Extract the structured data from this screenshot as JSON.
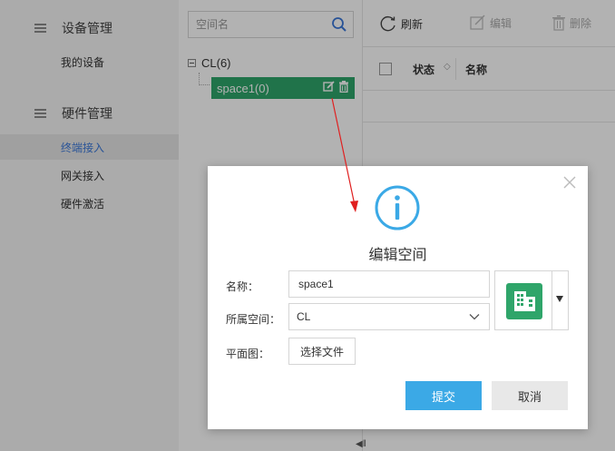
{
  "sidebar": {
    "sections": [
      {
        "title": "设备管理",
        "icon": "menu-icon",
        "items": [
          {
            "label": "我的设备",
            "active": false
          }
        ]
      },
      {
        "title": "硬件管理",
        "icon": "menu-icon",
        "items": [
          {
            "label": "终端接入",
            "active": true
          },
          {
            "label": "网关接入",
            "active": false
          },
          {
            "label": "硬件激活",
            "active": false
          }
        ]
      }
    ]
  },
  "tree": {
    "search_placeholder": "空间名",
    "search_icon": "search-icon",
    "root_label": "CL(6)",
    "selected_node_label": "space1(0)",
    "node_actions": [
      "edit-icon",
      "trash-icon"
    ]
  },
  "toolbar": {
    "refresh_label": "刷新",
    "edit_label": "编辑",
    "delete_label": "删除"
  },
  "table": {
    "columns": [
      "状态",
      "名称"
    ],
    "status_sort_glyph": "◇"
  },
  "dialog": {
    "title": "编辑空间",
    "icon": "info-icon",
    "name_label": "名称：",
    "name_value": "space1",
    "space_label": "所属空间：",
    "space_value": "CL",
    "floorplan_label": "平面图：",
    "choose_file_label": "选择文件",
    "building_icon": "building-icon",
    "submit_label": "提交",
    "cancel_label": "取消"
  },
  "colors": {
    "accent_blue": "#3ba9e6",
    "node_green": "#2fa56a",
    "active_link": "#3b78d8",
    "annotation_red": "#e02020"
  }
}
